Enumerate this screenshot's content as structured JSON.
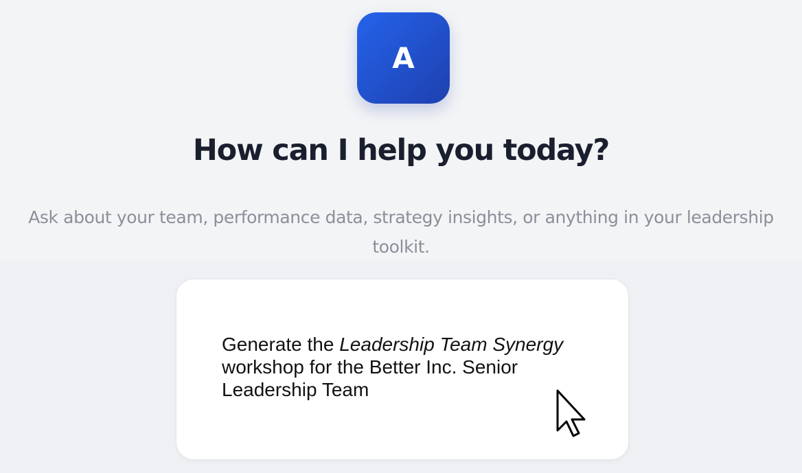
{
  "logo": {
    "letter": "A",
    "gradient_start": "#2563eb",
    "gradient_end": "#1e40af"
  },
  "heading": "How can I help you today?",
  "subtitle": "Ask about your team, performance data, strategy insights, or anything in your leadership toolkit.",
  "prompt_card": {
    "text_before": "Generate the ",
    "text_italic": "Leadership Team Synergy",
    "text_after": " workshop for the Better Inc. Senior Leadership Team"
  },
  "cursor": {
    "icon": "mouse-pointer-icon"
  },
  "colors": {
    "background": "#f3f4f6",
    "heading": "#1a1f2e",
    "subtitle": "#8a8f98",
    "card": "#ffffff"
  }
}
